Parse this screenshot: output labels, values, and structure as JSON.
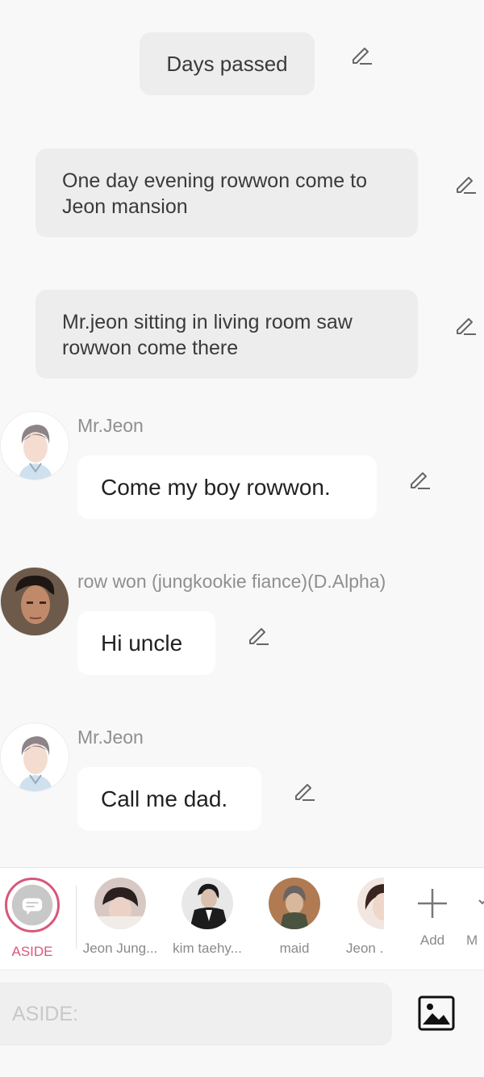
{
  "narrations": [
    {
      "text": "Days passed"
    },
    {
      "text": "One day evening rowwon come to Jeon mansion"
    },
    {
      "text": "Mr.jeon sitting in living room saw rowwon come there"
    }
  ],
  "messages": [
    {
      "speaker": "Mr.Jeon",
      "text": "Come my boy rowwon.",
      "avatar": "anime-man-avatar"
    },
    {
      "speaker": "row won (jungkookie fiance)(D.Alpha)",
      "text": "Hi uncle",
      "avatar": "man-photo-avatar"
    },
    {
      "speaker": "Mr.Jeon",
      "text": "Call me dad.",
      "avatar": "anime-man-avatar"
    }
  ],
  "characters": [
    {
      "label": "ASIDE",
      "icon": "aside-chat-icon",
      "selected": true,
      "color": "#d9577a"
    },
    {
      "label": "Jeon Jung...",
      "icon": "jeon-jungkook-avatar"
    },
    {
      "label": "kim taehy...",
      "icon": "kim-taehyung-avatar"
    },
    {
      "label": "maid",
      "icon": "maid-avatar"
    },
    {
      "label": "Jeon ...",
      "icon": "jeon-avatar"
    },
    {
      "label": "Add",
      "icon": "plus-icon"
    },
    {
      "label": "M",
      "icon": "more-icon"
    }
  ],
  "input": {
    "placeholder": "ASIDE:"
  },
  "colors": {
    "accent": "#d9577a",
    "background": "#f8f8f8",
    "narration_bg": "#ededed"
  }
}
